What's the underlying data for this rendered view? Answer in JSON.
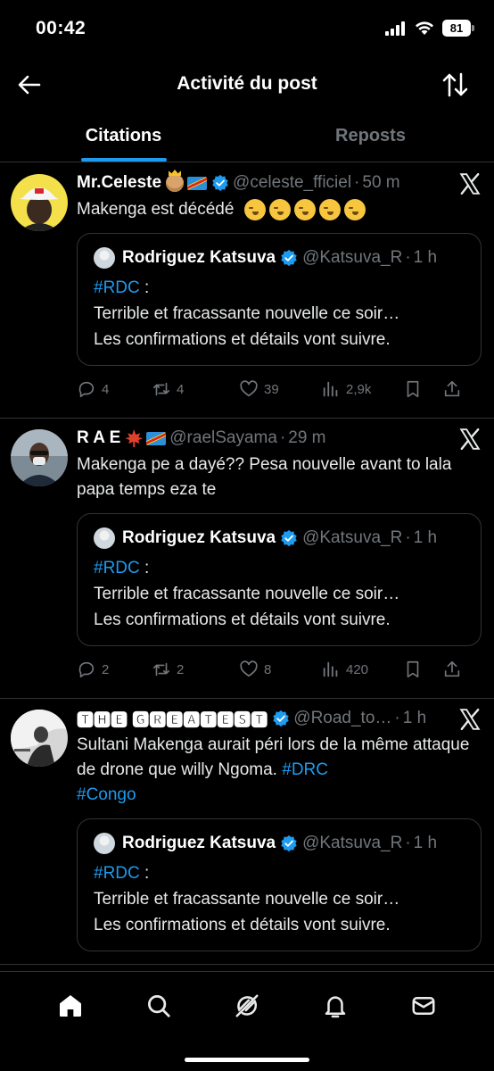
{
  "status_bar": {
    "time": "00:42",
    "battery": "81"
  },
  "header": {
    "title": "Activité du post",
    "back_icon": "arrow-left-icon",
    "sort_icon": "sort-arrows-icon"
  },
  "tabs": [
    {
      "label": "Citations",
      "active": true
    },
    {
      "label": "Reposts",
      "active": false
    }
  ],
  "posts": [
    {
      "name": "Mr.Celeste",
      "handle": "@celeste_fficiel",
      "time": "50 m",
      "text": "Makenga est décédé",
      "emoji_count_icons": "face-emoji-icon",
      "quote": {
        "name": "Rodriguez Katsuva",
        "handle": "@Katsuva_R",
        "time": "1 h",
        "hashtag": "#RDC",
        "after_hashtag": " :",
        "line1": "Terrible et fracassante nouvelle ce soir…",
        "line2": "Les confirmations et détails vont suivre."
      },
      "replies": "4",
      "reposts": "4",
      "likes": "39",
      "views": "2,9k"
    },
    {
      "name": "R A E",
      "handle": "@raelSayama",
      "time": "29 m",
      "text": "Makenga pe a dayé?? Pesa nouvelle avant to lala papa temps eza te",
      "quote": {
        "name": "Rodriguez Katsuva",
        "handle": "@Katsuva_R",
        "time": "1 h",
        "hashtag": "#RDC",
        "after_hashtag": " :",
        "line1": "Terrible et fracassante nouvelle ce soir…",
        "line2": "Les confirmations et détails vont suivre."
      },
      "replies": "2",
      "reposts": "2",
      "likes": "8",
      "views": "420"
    },
    {
      "name": "🆃🅷🅴 🅶🆁🅴🅰🆃🅴🆂🆃",
      "handle": "@Road_to…",
      "time": "1 h",
      "text_before": "Sultani Makenga aurait péri lors de la même attaque de drone que willy Ngoma. ",
      "hashtag1": "#DRC",
      "hashtag2": "#Congo",
      "quote": {
        "name": "Rodriguez Katsuva",
        "handle": "@Katsuva_R",
        "time": "1 h",
        "hashtag": "#RDC",
        "after_hashtag": " :",
        "line1": "Terrible et fracassante nouvelle ce soir…",
        "line2": "Les confirmations et détails vont suivre."
      }
    }
  ],
  "bottom_nav": [
    "home-icon",
    "search-icon",
    "grok-icon",
    "notifications-icon",
    "messages-icon"
  ],
  "colors": {
    "accent": "#1d9bf0",
    "background": "#000000",
    "muted": "#71767b",
    "divider": "#2f3336"
  }
}
